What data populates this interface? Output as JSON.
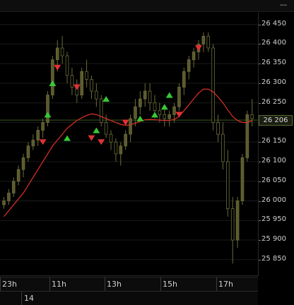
{
  "window": {
    "minimize_glyph": "—"
  },
  "chart_data": {
    "type": "candlestick",
    "title": "",
    "ylim": [
      25810,
      26480
    ],
    "y_ticks": [
      "26 450",
      "26 400",
      "26 350",
      "26 300",
      "26 250",
      "26 200",
      "26 150",
      "26 100",
      "26 050",
      "26 000",
      "25 950",
      "25 900",
      "25 850"
    ],
    "y_tick_values": [
      26450,
      26400,
      26350,
      26300,
      26250,
      26200,
      26150,
      26100,
      26050,
      26000,
      25950,
      25900,
      25850
    ],
    "x_ticks": [
      "23h",
      "11h",
      "13h",
      "15h",
      "17h"
    ],
    "date_label": "14",
    "last_price_label": "26 206",
    "last_price": 26206,
    "horizontal_line_value": 26206,
    "candles": [
      [
        25990,
        26010,
        25980,
        26000
      ],
      [
        26000,
        26030,
        25990,
        26020
      ],
      [
        26020,
        26060,
        26010,
        26050
      ],
      [
        26050,
        26090,
        26040,
        26080
      ],
      [
        26080,
        26120,
        26060,
        26110
      ],
      [
        26110,
        26150,
        26100,
        26140
      ],
      [
        26140,
        26170,
        26130,
        26155
      ],
      [
        26155,
        26190,
        26140,
        26180
      ],
      [
        26180,
        26210,
        26160,
        26200
      ],
      [
        26200,
        26280,
        26190,
        26270
      ],
      [
        26270,
        26370,
        26260,
        26360
      ],
      [
        26360,
        26410,
        26330,
        26390
      ],
      [
        26390,
        26420,
        26350,
        26370
      ],
      [
        26370,
        26380,
        26300,
        26320
      ],
      [
        26320,
        26340,
        26270,
        26290
      ],
      [
        26290,
        26310,
        26250,
        26270
      ],
      [
        26270,
        26340,
        26260,
        26330
      ],
      [
        26330,
        26360,
        26290,
        26310
      ],
      [
        26310,
        26320,
        26260,
        26280
      ],
      [
        26280,
        26300,
        26240,
        26260
      ],
      [
        26260,
        26270,
        26190,
        26200
      ],
      [
        26200,
        26220,
        26160,
        26170
      ],
      [
        26170,
        26180,
        26130,
        26150
      ],
      [
        26150,
        26160,
        26100,
        26120
      ],
      [
        26120,
        26150,
        26090,
        26140
      ],
      [
        26140,
        26180,
        26130,
        26170
      ],
      [
        26170,
        26220,
        26150,
        26210
      ],
      [
        26210,
        26260,
        26190,
        26240
      ],
      [
        26240,
        26280,
        26220,
        26260
      ],
      [
        26260,
        26300,
        26240,
        26280
      ],
      [
        26280,
        26300,
        26230,
        26250
      ],
      [
        26250,
        26270,
        26210,
        26230
      ],
      [
        26230,
        26250,
        26200,
        26220
      ],
      [
        26220,
        26240,
        26190,
        26210
      ],
      [
        26210,
        26230,
        26190,
        26220
      ],
      [
        26220,
        26250,
        26200,
        26240
      ],
      [
        26240,
        26300,
        26230,
        26290
      ],
      [
        26290,
        26340,
        26270,
        26330
      ],
      [
        26330,
        26370,
        26310,
        26360
      ],
      [
        26360,
        26390,
        26340,
        26380
      ],
      [
        26380,
        26410,
        26360,
        26400
      ],
      [
        26400,
        26430,
        26380,
        26420
      ],
      [
        26420,
        26430,
        26380,
        26390
      ],
      [
        26390,
        26400,
        26180,
        26200
      ],
      [
        26200,
        26220,
        26150,
        26170
      ],
      [
        26170,
        26200,
        26080,
        26100
      ],
      [
        26100,
        26130,
        25960,
        25980
      ],
      [
        25980,
        26010,
        25840,
        25900
      ],
      [
        25900,
        26010,
        25880,
        26000
      ],
      [
        26000,
        26120,
        25990,
        26110
      ],
      [
        26110,
        26230,
        26100,
        26220
      ],
      [
        26220,
        26260,
        26190,
        26210
      ]
    ],
    "moving_average": [
      25960,
      25975,
      25990,
      26005,
      26020,
      26040,
      26060,
      26080,
      26100,
      26120,
      26140,
      26155,
      26170,
      26185,
      26195,
      26205,
      26212,
      26218,
      26222,
      26220,
      26215,
      26210,
      26205,
      26200,
      26195,
      26193,
      26194,
      26198,
      26203,
      26207,
      26208,
      26207,
      26206,
      26205,
      26205,
      26208,
      26215,
      26230,
      26245,
      26260,
      26275,
      26285,
      26285,
      26278,
      26265,
      26250,
      26232,
      26215,
      26205,
      26200,
      26200,
      26205
    ],
    "buy_signals": [
      [
        9,
        26220
      ],
      [
        10,
        26300
      ],
      [
        13,
        26160
      ],
      [
        19,
        26180
      ],
      [
        21,
        26260
      ],
      [
        28,
        26210
      ],
      [
        31,
        26220
      ],
      [
        33,
        26240
      ],
      [
        34,
        26270
      ]
    ],
    "sell_signals": [
      [
        8,
        26150
      ],
      [
        11,
        26340
      ],
      [
        15,
        26290
      ],
      [
        18,
        26160
      ],
      [
        20,
        26150
      ],
      [
        25,
        26200
      ],
      [
        36,
        26220
      ],
      [
        40,
        26390
      ]
    ]
  },
  "colors": {
    "up": "#5a5a2e",
    "wick": "#6b6b3a",
    "ma": "#e0302a",
    "buy": "#37c837",
    "sell": "#e03232",
    "hline": "#3e5a1a",
    "grid": "#1a1a1a"
  }
}
